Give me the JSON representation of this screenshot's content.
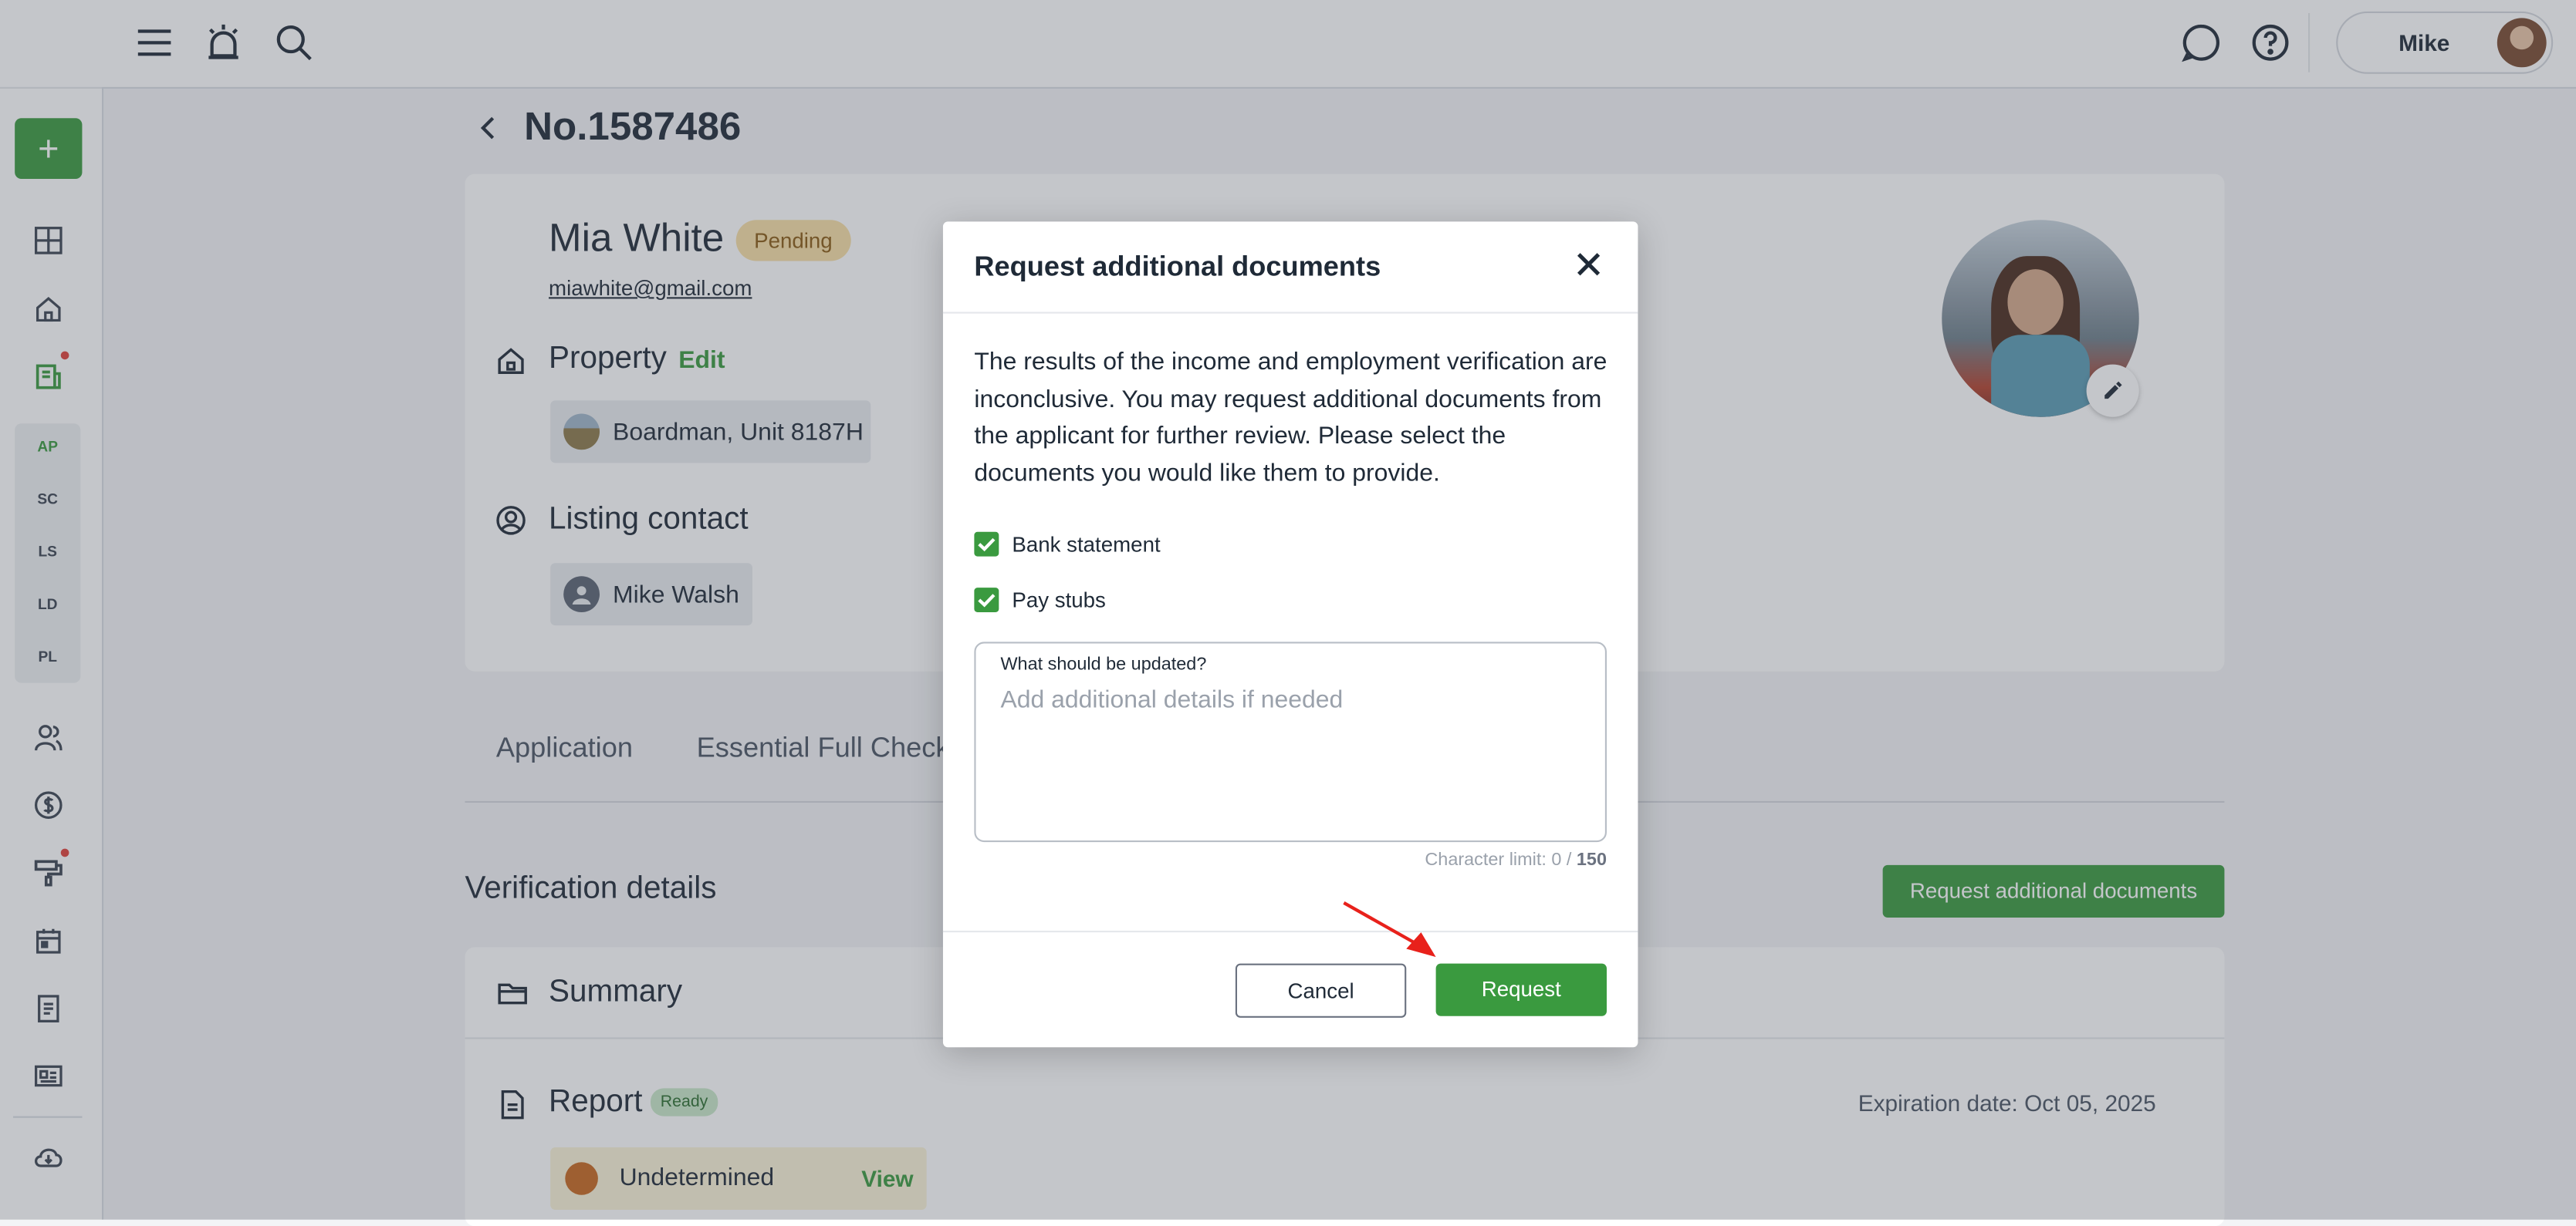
{
  "topbar": {
    "user_name": "Mike"
  },
  "sidebar": {
    "new_label": "+",
    "sub_items": [
      "AP",
      "SC",
      "LS",
      "LD",
      "PL"
    ]
  },
  "page": {
    "back": "‹",
    "title": "No.1587486"
  },
  "applicant": {
    "name": "Mia White",
    "status": "Pending",
    "email": "miawhite@gmail.com"
  },
  "property": {
    "title": "Property",
    "edit": "Edit",
    "address": "Boardman, Unit 8187H"
  },
  "listing_contact": {
    "title": "Listing contact",
    "name": "Mike Walsh"
  },
  "tabs": [
    "Application",
    "Essential Full Check"
  ],
  "verification": {
    "title": "Verification details",
    "request_button": "Request additional documents",
    "summary": "Summary",
    "report": "Report",
    "report_status": "Ready",
    "expiration": "Expiration date: Oct 05, 2025",
    "result": "Undetermined",
    "view": "View"
  },
  "modal": {
    "title": "Request additional documents",
    "description": "The results of the income and employment verification are inconclusive. You may request additional documents from the applicant for further review. Please select the documents you would like them to provide.",
    "options": [
      {
        "label": "Bank statement",
        "checked": true
      },
      {
        "label": "Pay stubs",
        "checked": true
      }
    ],
    "textarea_label": "What should be updated?",
    "textarea_placeholder": "Add additional details if needed",
    "limit_prefix": "Character limit: 0 / ",
    "limit_max": "150",
    "cancel": "Cancel",
    "request": "Request"
  },
  "colors": {
    "accent": "#3a9a3f",
    "pending_bg": "#f8dfa5",
    "annotation_arrow": "#e8211b"
  }
}
